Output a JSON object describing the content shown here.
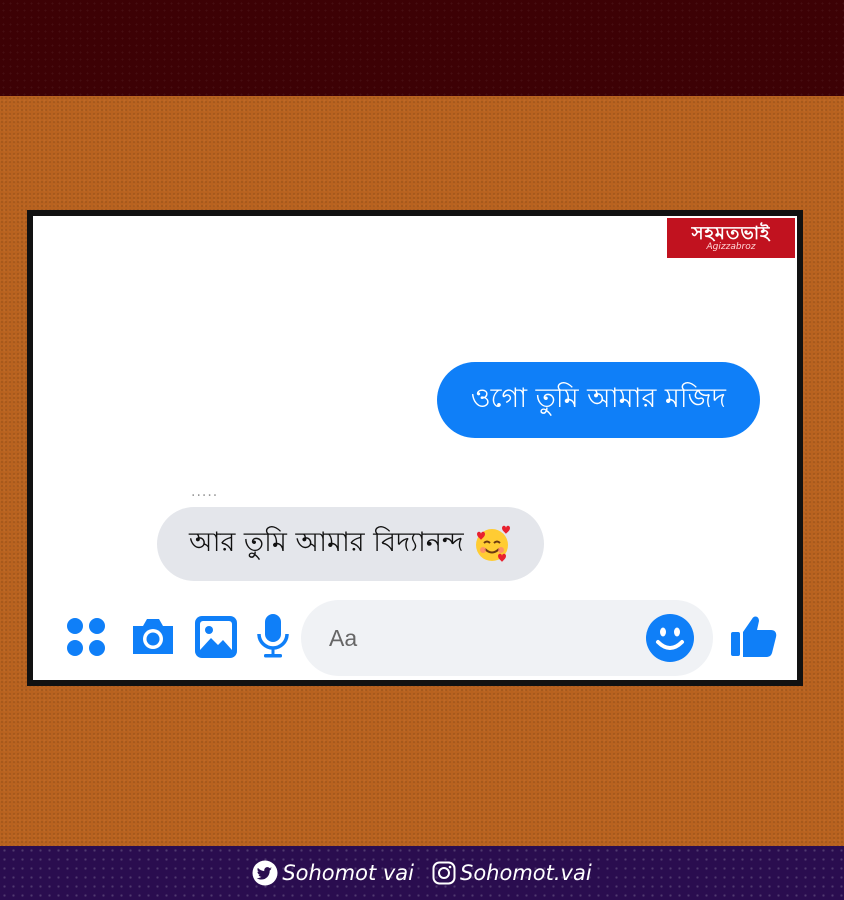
{
  "brand": {
    "logo_text": "সহমতভাই",
    "logo_subtext": "Agizzabroz"
  },
  "conversation": {
    "sent_message": "ওগো তুমি আমার মজিদ",
    "typing_indicator": ".....",
    "received_message": "আর তুমি আমার বিদ্যানন্দ",
    "received_emoji": "smiling-face-with-hearts"
  },
  "composer": {
    "placeholder": "Aa",
    "icons": [
      "menu-grid-icon",
      "camera-icon",
      "gallery-icon",
      "microphone-icon",
      "emoji-icon",
      "like-icon"
    ]
  },
  "footer": {
    "twitter_handle": "Sohomot vai",
    "instagram_handle": "Sohomot.vai"
  },
  "colors": {
    "messenger_blue": "#0f7ff8",
    "bubble_gray": "#e4e6eb",
    "background_orange": "#b8621f",
    "top_band": "#3d0105",
    "bottom_band": "#2a0d4f",
    "logo_red": "#c1121f"
  }
}
